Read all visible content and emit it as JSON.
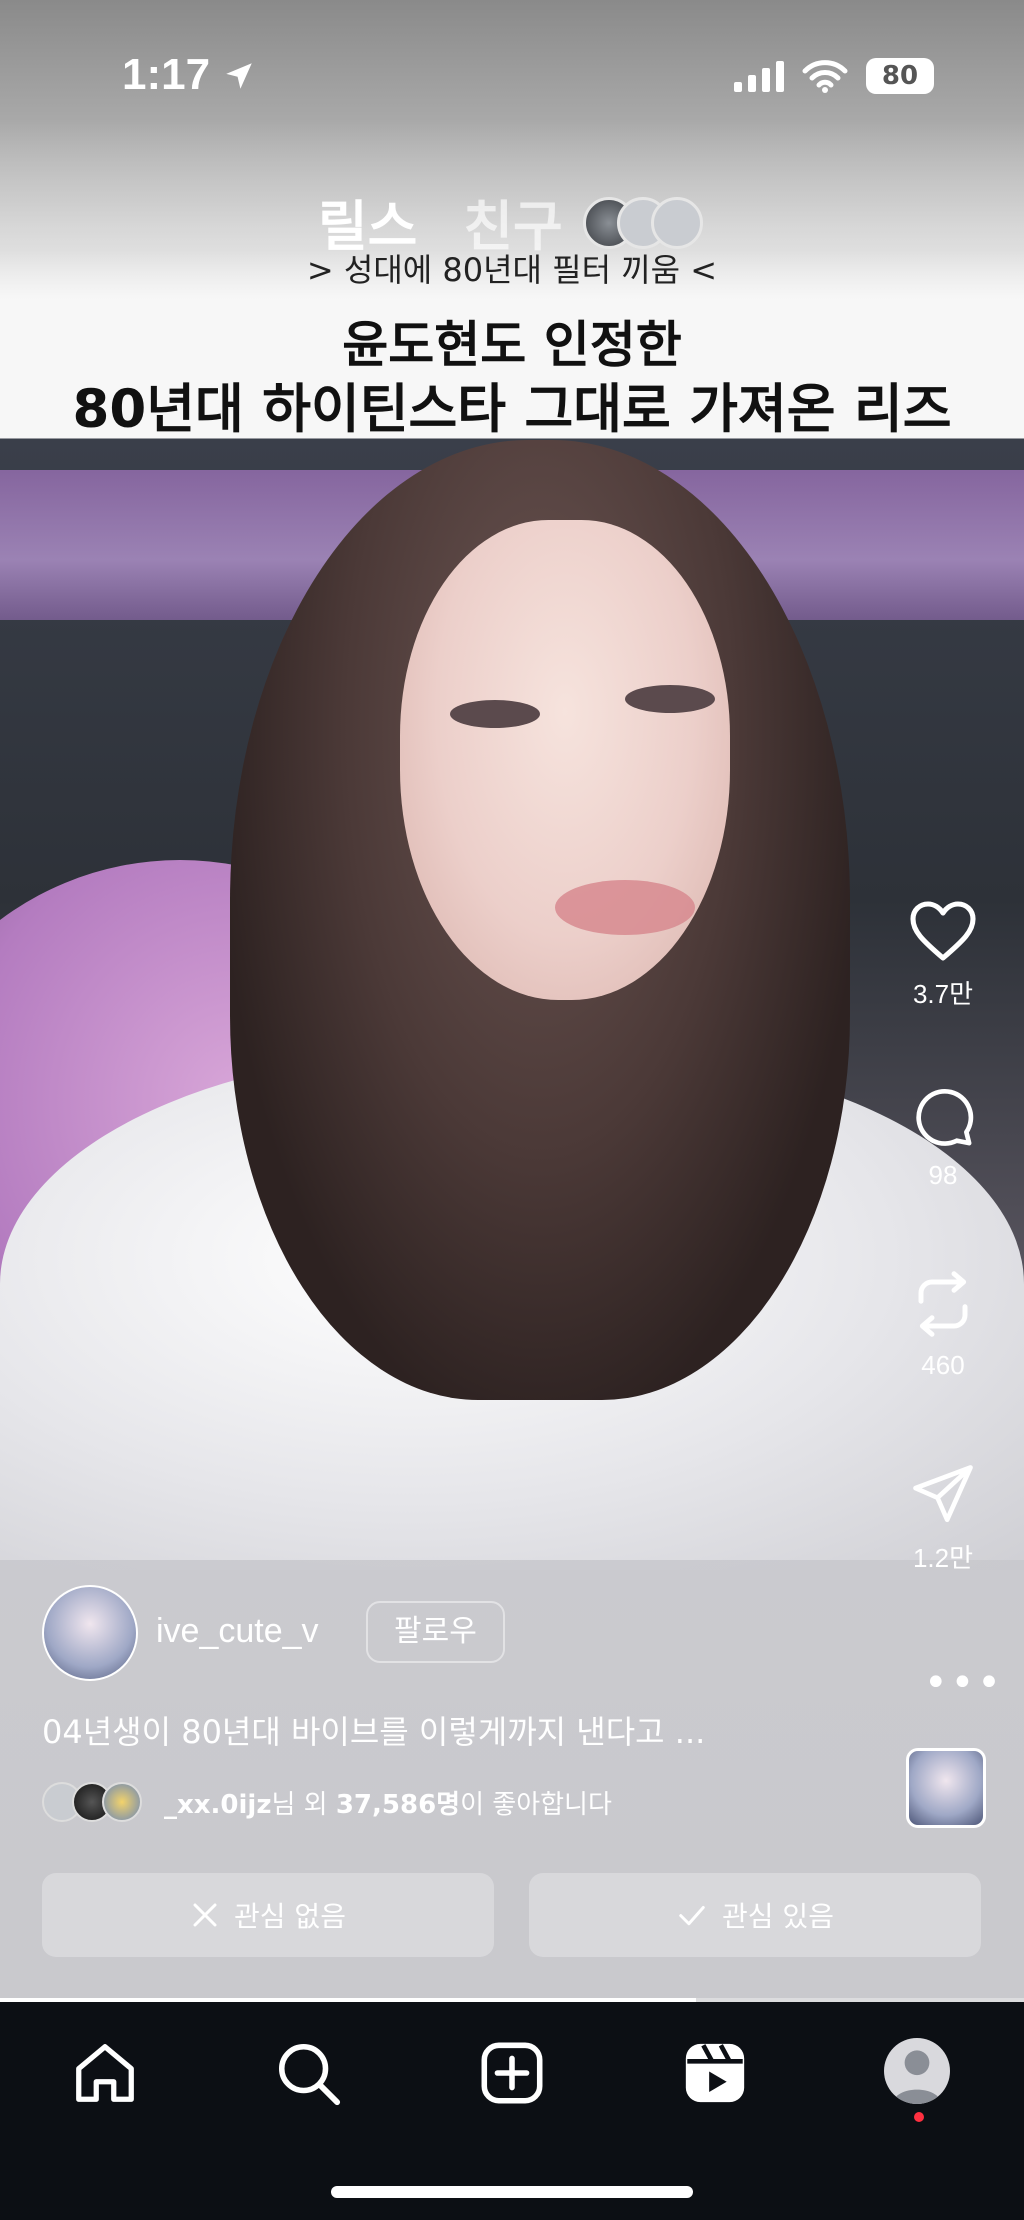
{
  "status_bar": {
    "time": "1:17",
    "battery": "80"
  },
  "header": {
    "tabs": [
      {
        "label": "릴스"
      },
      {
        "label": "친구"
      }
    ]
  },
  "video_text": {
    "subtitle": "> 성대에 80년대 필터 끼움 <",
    "headline_line1": "윤도현도 인정한",
    "headline_line2": "80년대 하이틴스타 그대로 가져온 리즈"
  },
  "actions": {
    "likes": "3.7만",
    "comments": "98",
    "reposts": "460",
    "shares": "1.2만"
  },
  "post": {
    "username": "ive_cute_v",
    "follow_label": "팔로우",
    "caption": "04년생이 80년대 바이브를 이렇게까지 낸다고 ...",
    "liked_by_user": "_xx.0ijz",
    "liked_by_mid": "님 외 ",
    "liked_by_count": "37,586명",
    "liked_by_suffix": "이 좋아합니다"
  },
  "buttons": {
    "not_interested": "관심 없음",
    "interested": "관심 있음"
  },
  "progress": 0.68,
  "nav": {
    "items": [
      "home-icon",
      "search-icon",
      "create-icon",
      "reels-icon",
      "profile-icon"
    ]
  },
  "colors": {
    "nav_bg": "#0c0f14",
    "notification_dot": "#ff3040"
  }
}
